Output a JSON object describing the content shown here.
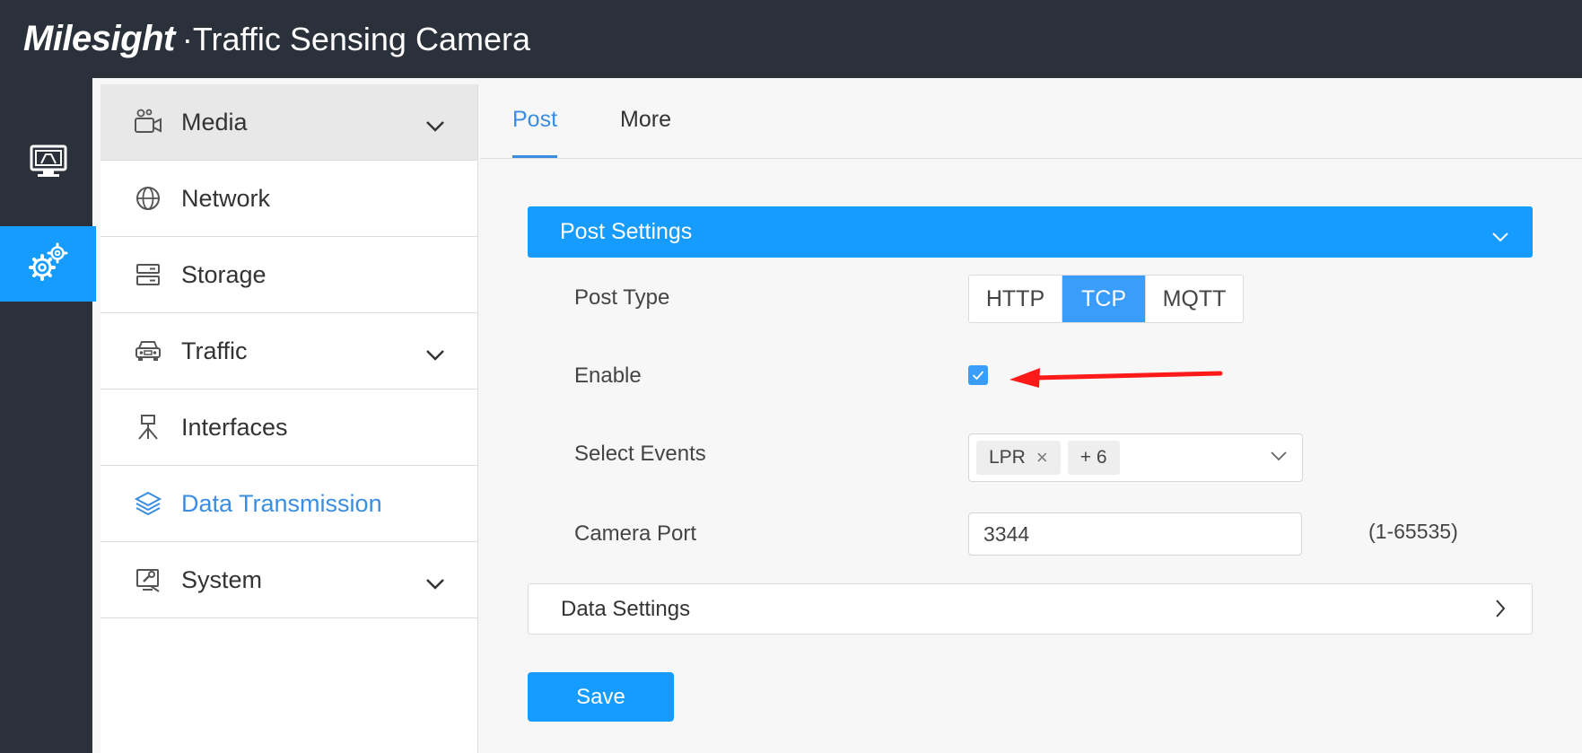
{
  "header": {
    "brand": "Milesight",
    "product": "·Traffic Sensing Camera"
  },
  "rail": {
    "items": [
      {
        "icon": "live-view-monitor-icon"
      },
      {
        "icon": "settings-gears-icon",
        "active": true
      }
    ]
  },
  "sidebar": {
    "items": [
      {
        "label": "Media",
        "icon": "camera-settings-icon",
        "expandable": true,
        "state": "open"
      },
      {
        "label": "Network",
        "icon": "globe-icon",
        "expandable": false
      },
      {
        "label": "Storage",
        "icon": "storage-server-icon",
        "expandable": false
      },
      {
        "label": "Traffic",
        "icon": "car-icon",
        "expandable": true
      },
      {
        "label": "Interfaces",
        "icon": "interface-icon",
        "expandable": false
      },
      {
        "label": "Data Transmission",
        "icon": "layers-icon",
        "expandable": false,
        "active": true
      },
      {
        "label": "System",
        "icon": "system-tools-icon",
        "expandable": true
      }
    ]
  },
  "tabs": [
    {
      "label": "Post",
      "active": true
    },
    {
      "label": "More"
    }
  ],
  "post_settings": {
    "title": "Post Settings",
    "post_type_label": "Post Type",
    "post_type_options": [
      "HTTP",
      "TCP",
      "MQTT"
    ],
    "post_type_selected": "TCP",
    "enable_label": "Enable",
    "enable_checked": true,
    "events_label": "Select Events",
    "events_tag": "LPR",
    "events_more": "+ 6",
    "port_label": "Camera Port",
    "port_value": "3344",
    "port_hint": "(1-65535)"
  },
  "data_settings": {
    "title": "Data Settings"
  },
  "save_label": "Save",
  "colors": {
    "header_bg": "#2b313b",
    "accent": "#169bff",
    "link": "#3a8de0",
    "arrow": "#ff1a1a"
  }
}
